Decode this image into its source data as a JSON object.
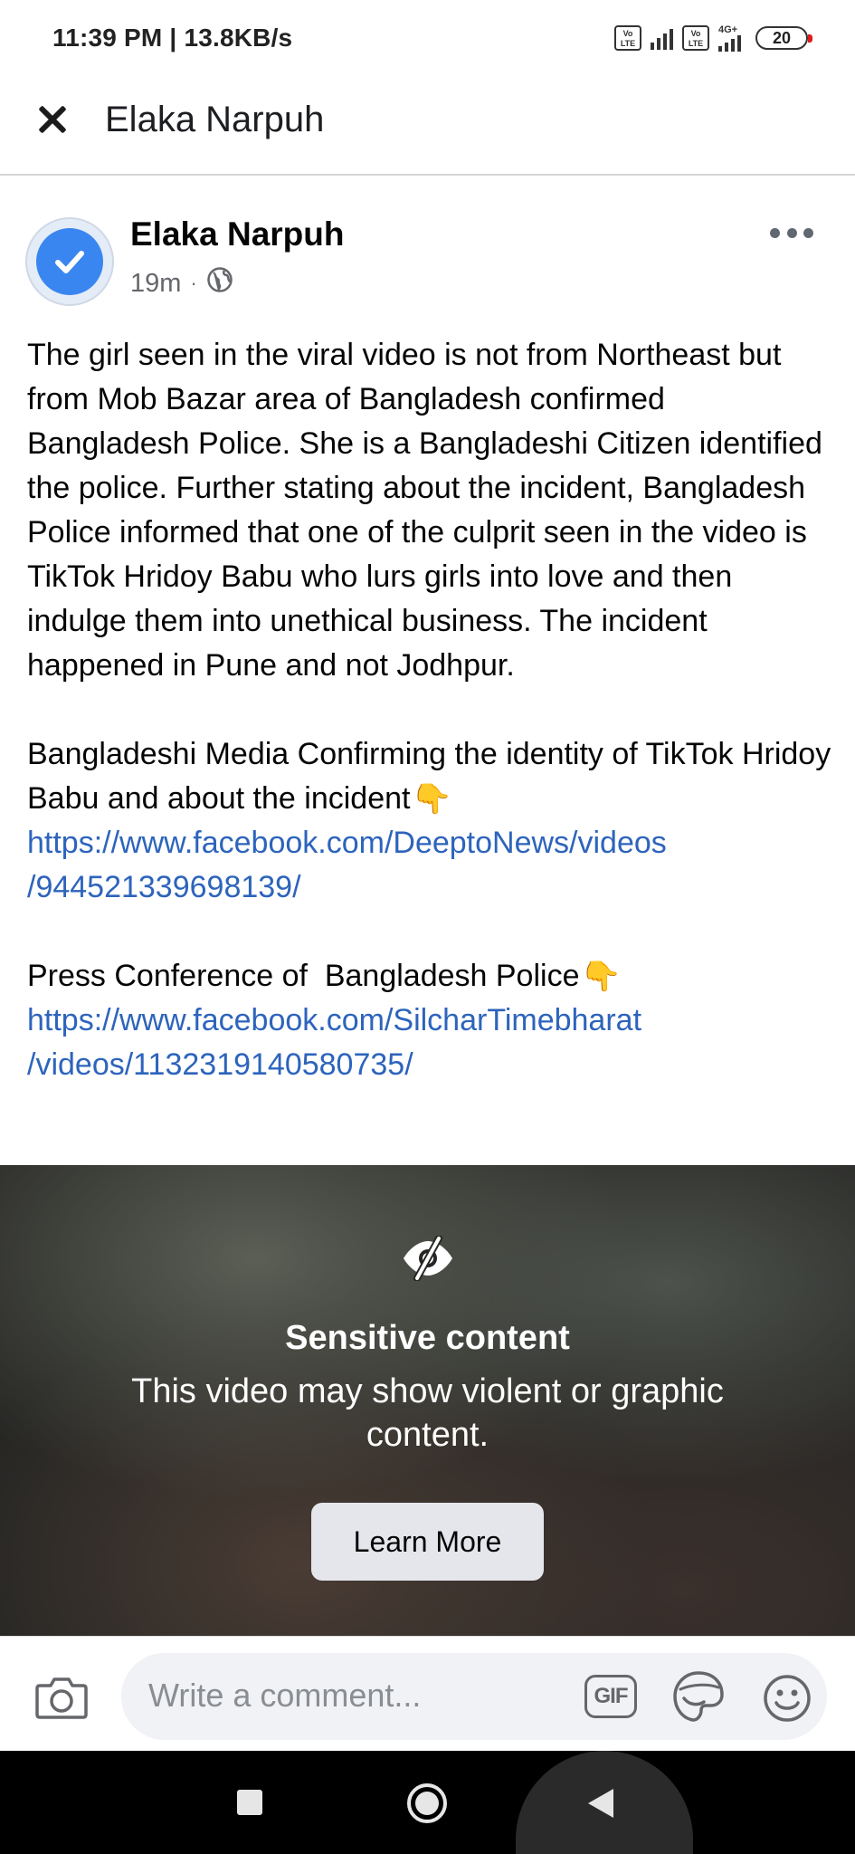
{
  "status_bar": {
    "time": "11:39 PM | 13.8KB/s",
    "volte_label": "Vo\nLTE",
    "network_label": "4G+",
    "battery_level": "20"
  },
  "header": {
    "title": "Elaka Narpuh"
  },
  "post": {
    "author": "Elaka Narpuh",
    "time_ago": "19m",
    "separator": "·",
    "paragraph_1": "The girl seen in the viral video is not from Northeast but from Mob Bazar area of Bangladesh confirmed Bangladesh Police. She is a Bangladeshi Citizen identified the police. Further stating about the incident, Bangladesh Police informed that one of the culprit seen in the video is TikTok Hridoy Babu who lurs girls into love and then indulge them into unethical business. The incident happened in Pune and not Jodhpur.",
    "paragraph_2": "Bangladeshi Media Confirming the identity of TikTok Hridoy Babu and about the incident",
    "link_1_line_1": "https://www.facebook.com/DeeptoNews/videos",
    "link_1_line_2": "/944521339698139/",
    "paragraph_3": "Press Conference of  Bangladesh Police",
    "link_2_line_1": "https://www.facebook.com/SilcharTimebharat",
    "link_2_line_2": "/videos/1132319140580735/",
    "pointing_emoji": "👇"
  },
  "sensitive": {
    "title": "Sensitive content",
    "description": "This video may show violent or graphic content.",
    "button_label": "Learn More"
  },
  "comment_bar": {
    "placeholder": "Write a comment...",
    "gif_label": "GIF"
  },
  "colors": {
    "link": "#2d64bc",
    "verified_badge": "#3a86f0",
    "button_bg": "#e4e6eb"
  }
}
